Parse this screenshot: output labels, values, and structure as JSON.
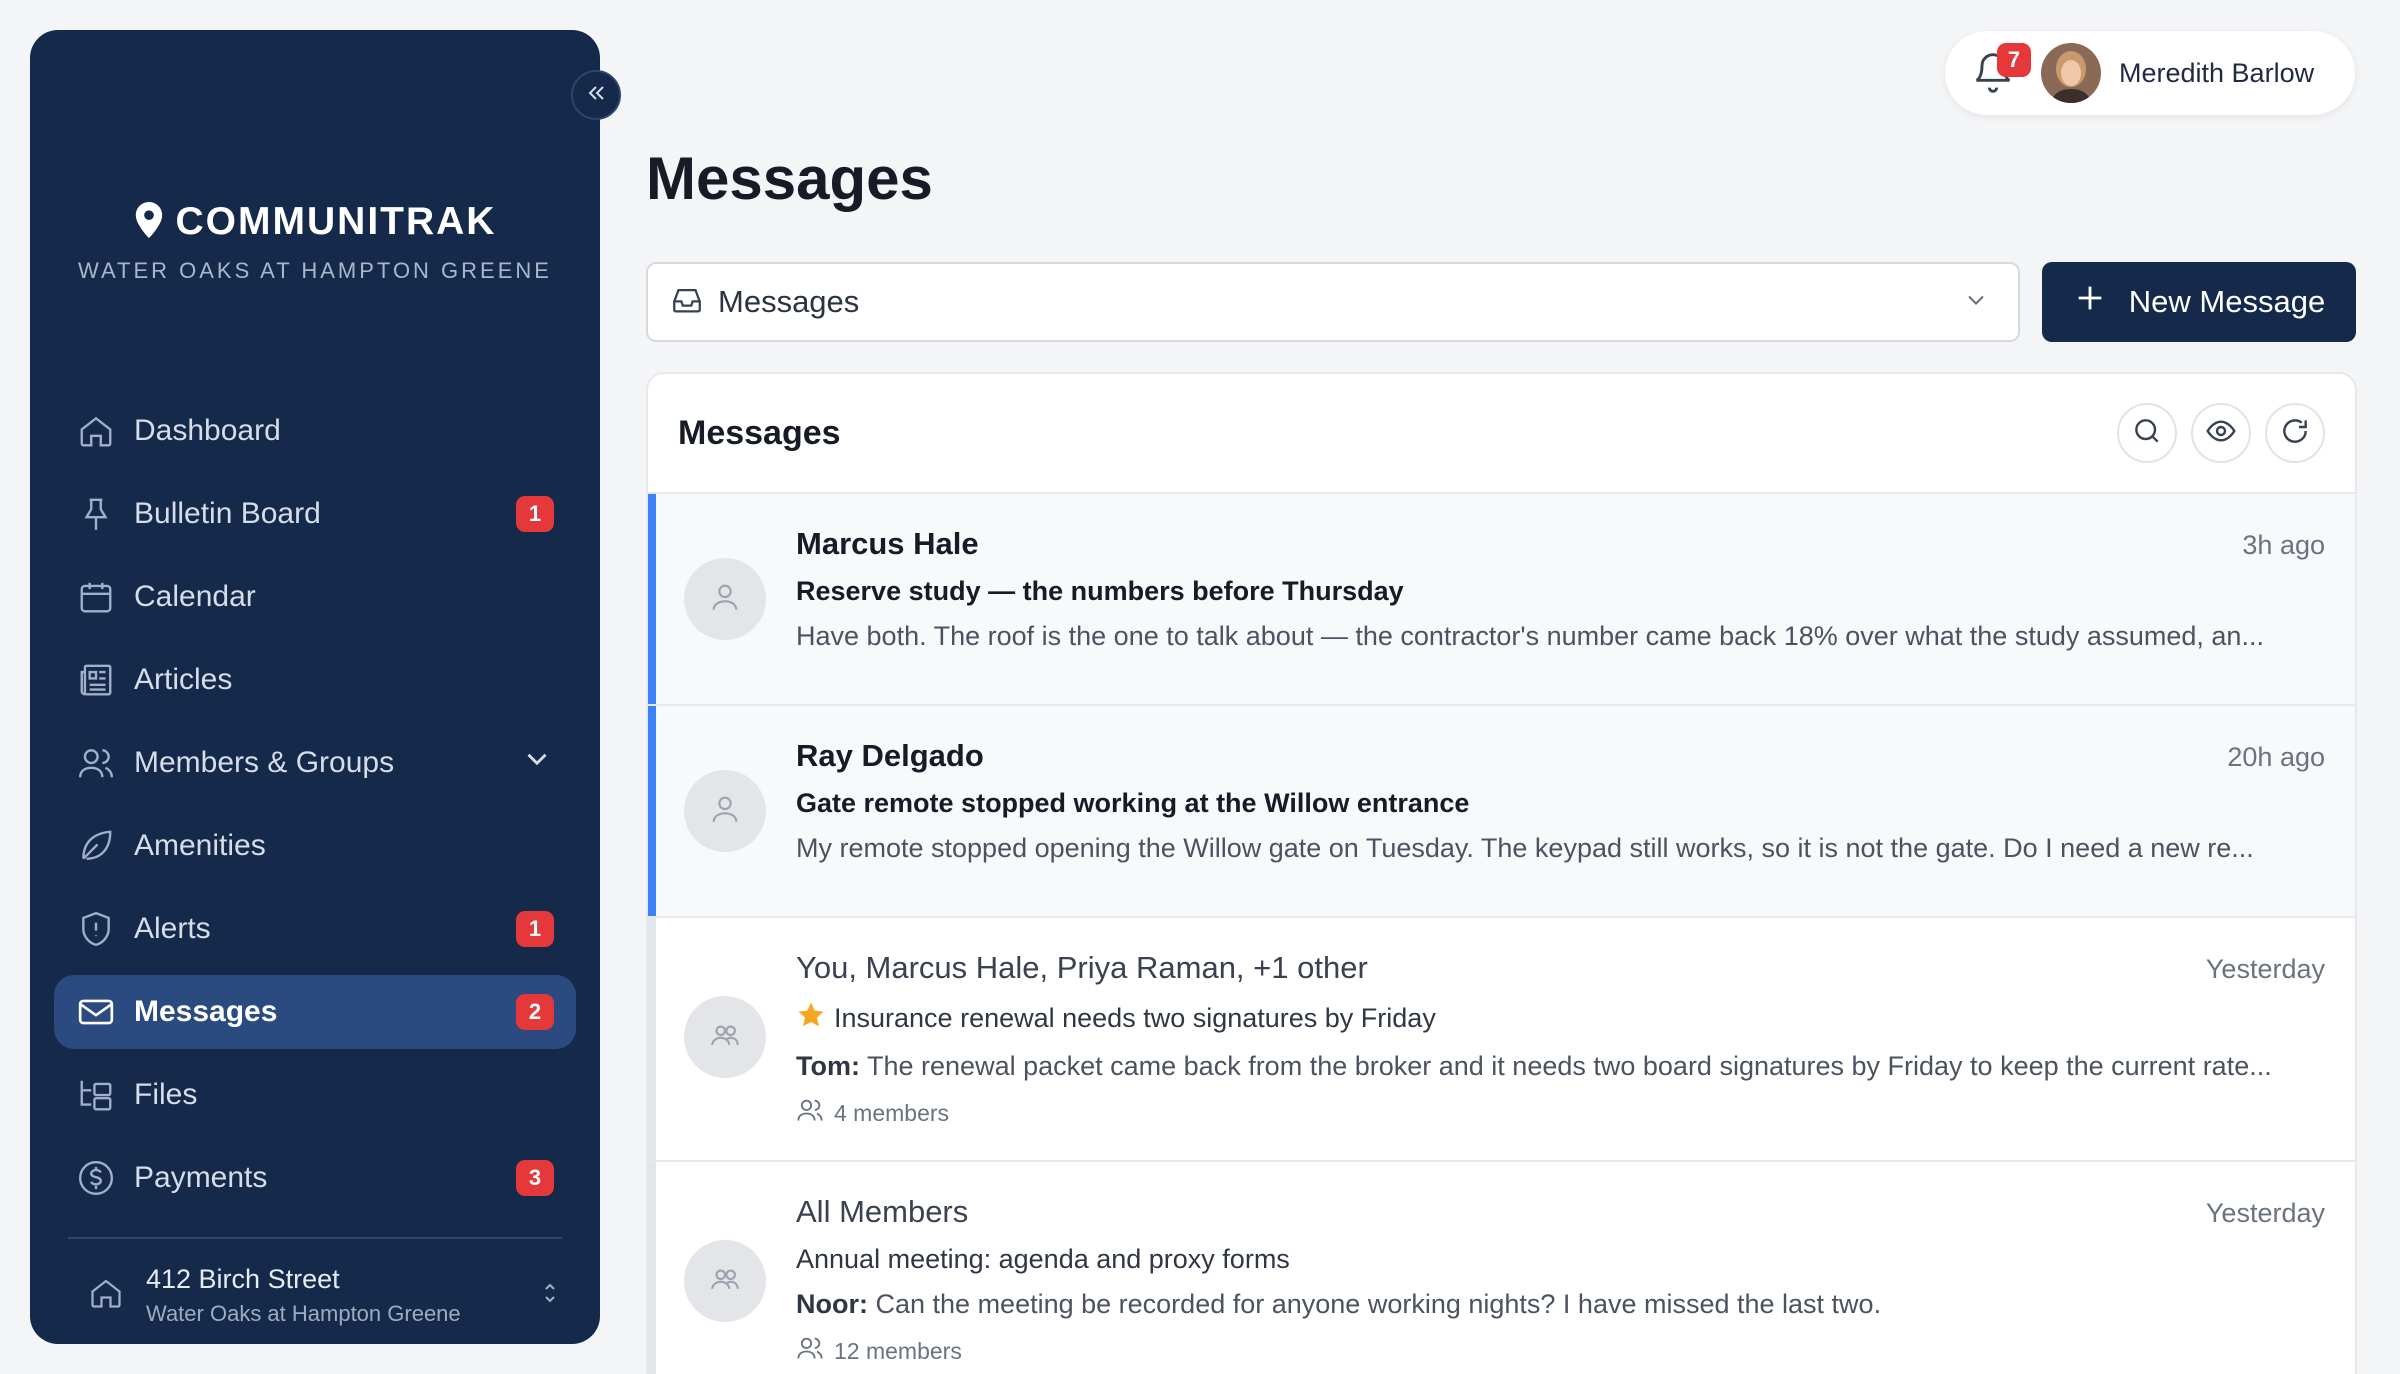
{
  "brand": {
    "name": "COMMUNITRAK",
    "subtitle": "WATER OAKS AT HAMPTON GREENE"
  },
  "sidebar": {
    "items": [
      {
        "label": "Dashboard",
        "icon": "home-icon",
        "badge": ""
      },
      {
        "label": "Bulletin Board",
        "icon": "pin-icon",
        "badge": "1"
      },
      {
        "label": "Calendar",
        "icon": "calendar-icon",
        "badge": ""
      },
      {
        "label": "Articles",
        "icon": "newspaper-icon",
        "badge": ""
      },
      {
        "label": "Members & Groups",
        "icon": "users-icon",
        "badge": ""
      },
      {
        "label": "Amenities",
        "icon": "leaf-icon",
        "badge": ""
      },
      {
        "label": "Alerts",
        "icon": "shield-alert-icon",
        "badge": "1"
      },
      {
        "label": "Messages",
        "icon": "mail-icon",
        "badge": "2",
        "active": true
      },
      {
        "label": "Files",
        "icon": "folder-tree-icon",
        "badge": ""
      },
      {
        "label": "Payments",
        "icon": "dollar-circle-icon",
        "badge": "3"
      }
    ],
    "property": {
      "address": "412 Birch Street",
      "community": "Water Oaks at Hampton Greene"
    }
  },
  "header": {
    "notifications_count": "7",
    "user_name": "Meredith Barlow"
  },
  "page": {
    "title": "Messages",
    "folder_select": "Messages",
    "new_message_label": "New Message"
  },
  "panel": {
    "title": "Messages",
    "messages": [
      {
        "sender": "Marcus Hale",
        "time": "3h ago",
        "subject": "Reserve study — the numbers before Thursday",
        "preview_author": "",
        "preview": "Have both. The roof is the one to talk about — the contractor's number came back 18% over what the study assumed, an...",
        "members": "",
        "unread": true
      },
      {
        "sender": "Ray Delgado",
        "time": "20h ago",
        "subject": "Gate remote stopped working at the Willow entrance",
        "preview_author": "",
        "preview": "My remote stopped opening the Willow gate on Tuesday. The keypad still works, so it is not the gate. Do I need a new re...",
        "members": "",
        "unread": true
      },
      {
        "sender": "You, Marcus Hale, Priya Raman, +1 other",
        "time": "Yesterday",
        "subject": "Insurance renewal needs two signatures by Friday",
        "starred": true,
        "preview_author": "Tom:",
        "preview": "The renewal packet came back from the broker and it needs two board signatures by Friday to keep the current rate...",
        "members": "4 members",
        "unread": false
      },
      {
        "sender": "All Members",
        "time": "Yesterday",
        "subject": "Annual meeting: agenda and proxy forms",
        "preview_author": "Noor:",
        "preview": "Can the meeting be recorded for anyone working nights? I have missed the last two.",
        "members": "12 members",
        "unread": false
      }
    ]
  },
  "colors": {
    "sidebar": "#15294a",
    "active": "#2a4a80",
    "badge": "#e5383b",
    "unread_bar": "#3b82f6",
    "star": "#f5a623"
  }
}
